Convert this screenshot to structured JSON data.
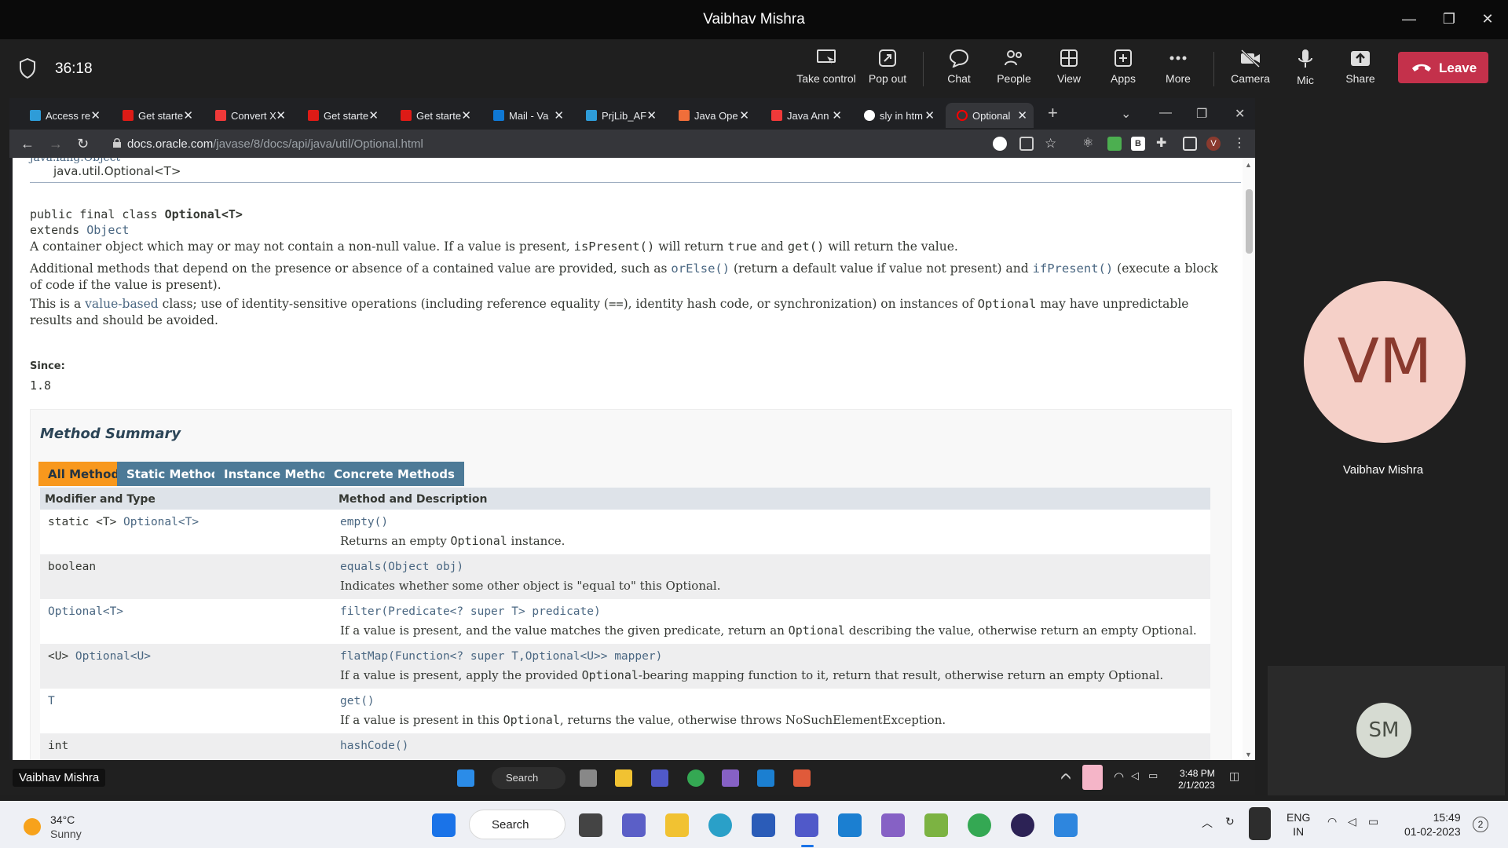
{
  "window": {
    "title": "Vaibhav Mishra"
  },
  "meeting": {
    "timer": "36:18",
    "tools": [
      {
        "label": "Take control"
      },
      {
        "label": "Pop out"
      },
      {
        "label": "Chat"
      },
      {
        "label": "People"
      },
      {
        "label": "View"
      },
      {
        "label": "Apps"
      },
      {
        "label": "More"
      },
      {
        "label": "Camera"
      },
      {
        "label": "Mic"
      },
      {
        "label": "Share"
      }
    ],
    "leave_label": "Leave",
    "leave_color": "#c4314b"
  },
  "browser": {
    "tabs": [
      {
        "label": "Access re",
        "icon": "azure-icon"
      },
      {
        "label": "Get starte",
        "icon": "angular-icon"
      },
      {
        "label": "Convert X",
        "icon": "vivaldi-icon"
      },
      {
        "label": "Get starte",
        "icon": "angular-icon"
      },
      {
        "label": "Get starte",
        "icon": "angular-icon"
      },
      {
        "label": "Mail - Va",
        "icon": "outlook-icon"
      },
      {
        "label": "PrjLib_AF",
        "icon": "azure-icon"
      },
      {
        "label": "Java Ope",
        "icon": "java-icon"
      },
      {
        "label": "Java Ann",
        "icon": "vivaldi-icon"
      },
      {
        "label": "sly in htm",
        "icon": "google-icon"
      },
      {
        "label": "Optional",
        "icon": "oracle-icon"
      }
    ],
    "url_host": "docs.oracle.com",
    "url_path": "/javase/8/docs/api/java/util/Optional.html"
  },
  "doc": {
    "inherit_parent": "java.lang.Object",
    "inherit_class": "java.util.Optional<T>",
    "decl_line1_prefix": "public final class ",
    "decl_line1_name": "Optional<T>",
    "decl_line2_prefix": "extends ",
    "decl_line2_link": "Object",
    "p1": {
      "a": "A container object which may or may not contain a non-null value. If a value is present, ",
      "code1": "isPresent()",
      "b": " will return ",
      "code2": "true",
      "c": " and ",
      "code3": "get()",
      "d": " will return the value."
    },
    "p2": {
      "a": "Additional methods that depend on the presence or absence of a contained value are provided, such as ",
      "link1": "orElse()",
      "b": " (return a default value if value not present) and ",
      "link2": "ifPresent()",
      "c": " (execute a block of code if the value is present)."
    },
    "p3": {
      "a": "This is a ",
      "link": "value-based",
      "b": " class; use of identity-sensitive operations (including reference equality (",
      "code1": "==",
      "c": "), identity hash code, or synchronization) on instances of ",
      "code2": "Optional",
      "d": " may have unpredictable results and should be avoided."
    },
    "since_label": "Since:",
    "since_value": "1.8",
    "summary_title": "Method Summary",
    "method_tabs": [
      "All Methods",
      "Static Methods",
      "Instance Methods",
      "Concrete Methods"
    ],
    "columns": [
      "Modifier and Type",
      "Method and Description"
    ],
    "rows": [
      {
        "type": "static <T> ",
        "type_link": "Optional<T>",
        "method": "empty()",
        "desc_a": "Returns an empty ",
        "desc_code": "Optional",
        "desc_b": " instance."
      },
      {
        "type": "boolean",
        "type_link": "",
        "method": "equals(Object obj)",
        "desc_a": "Indicates whether some other object is \"equal to\" this Optional.",
        "desc_code": "",
        "desc_b": ""
      },
      {
        "type": "",
        "type_link": "Optional<T>",
        "method": "filter(Predicate<? super T> predicate)",
        "desc_a": "If a value is present, and the value matches the given predicate, return an ",
        "desc_code": "Optional",
        "desc_b": " describing the value, otherwise return an empty Optional."
      },
      {
        "type": "<U> ",
        "type_link": "Optional<U>",
        "method": "flatMap(Function<? super T,Optional<U>> mapper)",
        "desc_a": "If a value is present, apply the provided ",
        "desc_code": "Optional",
        "desc_b": "-bearing mapping function to it, return that result, otherwise return an empty Optional."
      },
      {
        "type": "",
        "type_link": "T",
        "method": "get()",
        "desc_a": "If a value is present in this ",
        "desc_code": "Optional",
        "desc_b": ", returns the value, otherwise throws NoSuchElementException."
      },
      {
        "type": "int",
        "type_link": "",
        "method": "hashCode()",
        "desc_a": "",
        "desc_code": "",
        "desc_b": ""
      }
    ]
  },
  "participants": {
    "main_initials": "VM",
    "main_name": "Vaibhav Mishra",
    "self_initials": "SM"
  },
  "remote_taskbar": {
    "name_tag": "Vaibhav Mishra",
    "search": "Search",
    "time": "3:48 PM",
    "date": "2/1/2023"
  },
  "host_taskbar": {
    "temp": "34°C",
    "condition": "Sunny",
    "search": "Search",
    "lang1": "ENG",
    "lang2": "IN",
    "time": "15:49",
    "date": "01-02-2023",
    "notifications": "2"
  }
}
